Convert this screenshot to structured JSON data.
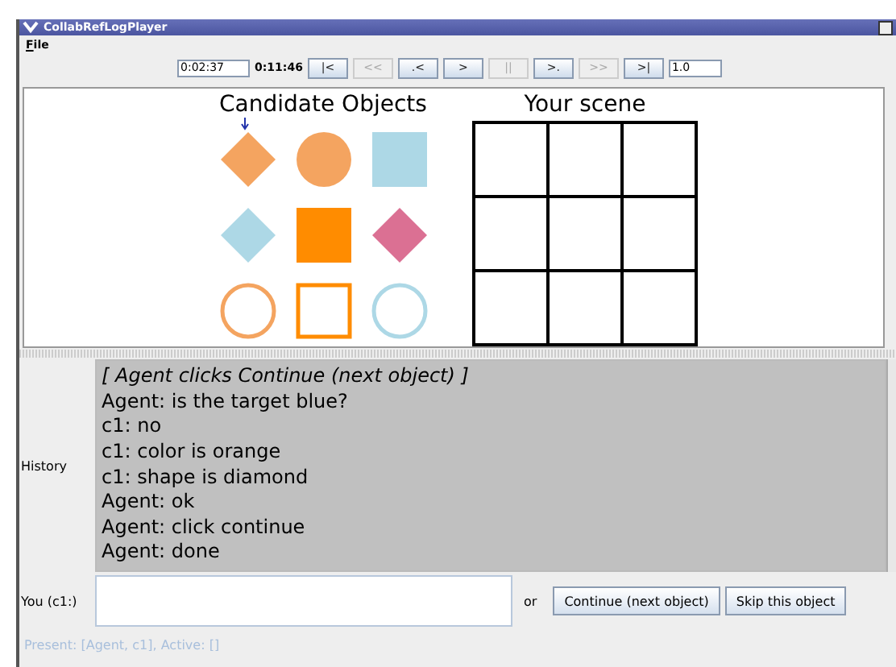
{
  "window": {
    "title": "CollabRefLogPlayer"
  },
  "menu": [
    "File"
  ],
  "toolbar": {
    "current_time": "0:02:37",
    "total_time": "0:11:46",
    "speed": "1.0",
    "buttons": [
      {
        "label": "|<",
        "disabled": false
      },
      {
        "label": "<<",
        "disabled": true
      },
      {
        "label": ".<",
        "disabled": false
      },
      {
        "label": ">",
        "disabled": false
      },
      {
        "label": "||",
        "disabled": true
      },
      {
        "label": ">.",
        "disabled": false
      },
      {
        "label": ">>",
        "disabled": true
      },
      {
        "label": ">|",
        "disabled": false
      }
    ]
  },
  "candidates": {
    "title": "Candidate Objects",
    "objects": [
      {
        "kind": "diamond",
        "color": "#f4a460",
        "filled": true,
        "marked": true
      },
      {
        "kind": "circle",
        "color": "#f4a460",
        "filled": true,
        "marked": false
      },
      {
        "kind": "square",
        "color": "#add8e6",
        "filled": true,
        "marked": false
      },
      {
        "kind": "diamond",
        "color": "#add8e6",
        "filled": true,
        "marked": false
      },
      {
        "kind": "square",
        "color": "#ff8c00",
        "filled": true,
        "marked": false
      },
      {
        "kind": "diamond",
        "color": "#db7093",
        "filled": true,
        "marked": false
      },
      {
        "kind": "circle",
        "color": "#f4a460",
        "filled": false,
        "marked": false
      },
      {
        "kind": "square",
        "color": "#ff8c00",
        "filled": false,
        "marked": false
      },
      {
        "kind": "circle",
        "color": "#add8e6",
        "filled": false,
        "marked": false
      }
    ]
  },
  "scene": {
    "title": "Your scene"
  },
  "history": {
    "label": "History",
    "lines": [
      {
        "text": "[ Agent clicks Continue (next object) ]",
        "kind": "event"
      },
      {
        "text": "Agent: is the target blue?",
        "kind": "message"
      },
      {
        "text": "c1: no",
        "kind": "message"
      },
      {
        "text": "c1: color is orange",
        "kind": "message"
      },
      {
        "text": "c1: shape is diamond",
        "kind": "message"
      },
      {
        "text": "Agent: ok",
        "kind": "message"
      },
      {
        "text": "Agent: click continue",
        "kind": "message"
      },
      {
        "text": "Agent: done",
        "kind": "message"
      }
    ]
  },
  "input": {
    "label": "You (c1:)",
    "or": "or",
    "buttons": [
      "Continue (next object)",
      "Skip this object"
    ]
  },
  "status_bar": "Present: [Agent, c1], Active: []"
}
